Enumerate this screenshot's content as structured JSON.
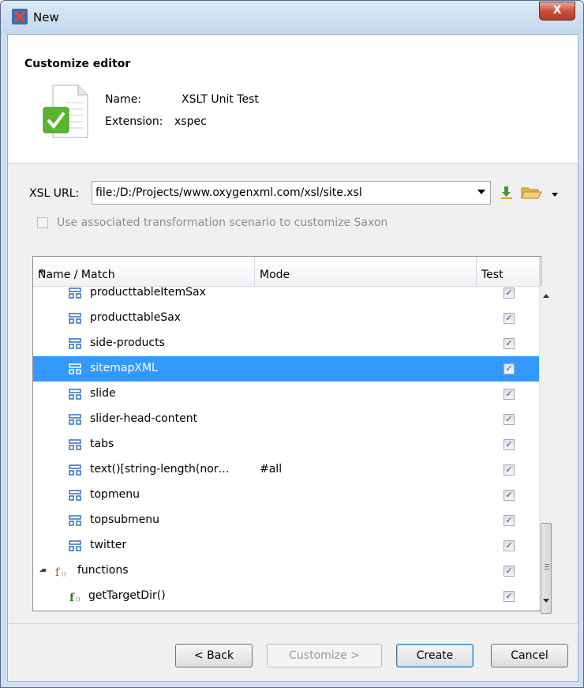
{
  "window": {
    "title": "New",
    "close_label": "X"
  },
  "header": {
    "title": "Customize editor",
    "name_label": "Name:",
    "name_value": "XSLT Unit Test",
    "extension_label": "Extension:",
    "extension_value": "xspec"
  },
  "xsl": {
    "label": "XSL URL:",
    "url": "file:/D:/Projects/www.oxygenxml.com/xsl/site.xsl"
  },
  "scenario_checkbox": {
    "label": "Use associated transformation scenario to customize Saxon",
    "checked": false,
    "enabled": false
  },
  "tree": {
    "columns": [
      "Name / Match",
      "Mode",
      "Test"
    ],
    "rows": [
      {
        "label": "producttableItemSax",
        "mode": "",
        "icon": "template-icon",
        "test": true,
        "selected": false
      },
      {
        "label": "producttableSax",
        "mode": "",
        "icon": "template-icon",
        "test": true,
        "selected": false
      },
      {
        "label": "side-products",
        "mode": "",
        "icon": "template-icon",
        "test": true,
        "selected": false
      },
      {
        "label": "sitemapXML",
        "mode": "",
        "icon": "template-icon",
        "test": true,
        "selected": true
      },
      {
        "label": "slide",
        "mode": "",
        "icon": "template-icon",
        "test": true,
        "selected": false
      },
      {
        "label": "slider-head-content",
        "mode": "",
        "icon": "template-icon",
        "test": true,
        "selected": false
      },
      {
        "label": "tabs",
        "mode": "",
        "icon": "template-icon",
        "test": true,
        "selected": false
      },
      {
        "label": "text()[string-length(nor…",
        "mode": "#all",
        "icon": "template-icon",
        "test": true,
        "selected": false
      },
      {
        "label": "topmenu",
        "mode": "",
        "icon": "template-icon",
        "test": true,
        "selected": false
      },
      {
        "label": "topsubmenu",
        "mode": "",
        "icon": "template-icon",
        "test": true,
        "selected": false
      },
      {
        "label": "twitter",
        "mode": "",
        "icon": "template-icon",
        "test": true,
        "selected": false
      },
      {
        "label": "functions",
        "mode": "",
        "icon": "functions-group-icon",
        "test": true,
        "selected": false
      },
      {
        "label": "getTargetDir()",
        "mode": "",
        "icon": "function-icon",
        "test": true,
        "selected": false
      }
    ]
  },
  "buttons": {
    "back": "< Back",
    "customize": "Customize >",
    "create": "Create",
    "cancel": "Cancel"
  },
  "colors": {
    "selection": "#3399ff",
    "template_icon": "#2f6fbf",
    "function_icon": "#2d7d1c"
  }
}
